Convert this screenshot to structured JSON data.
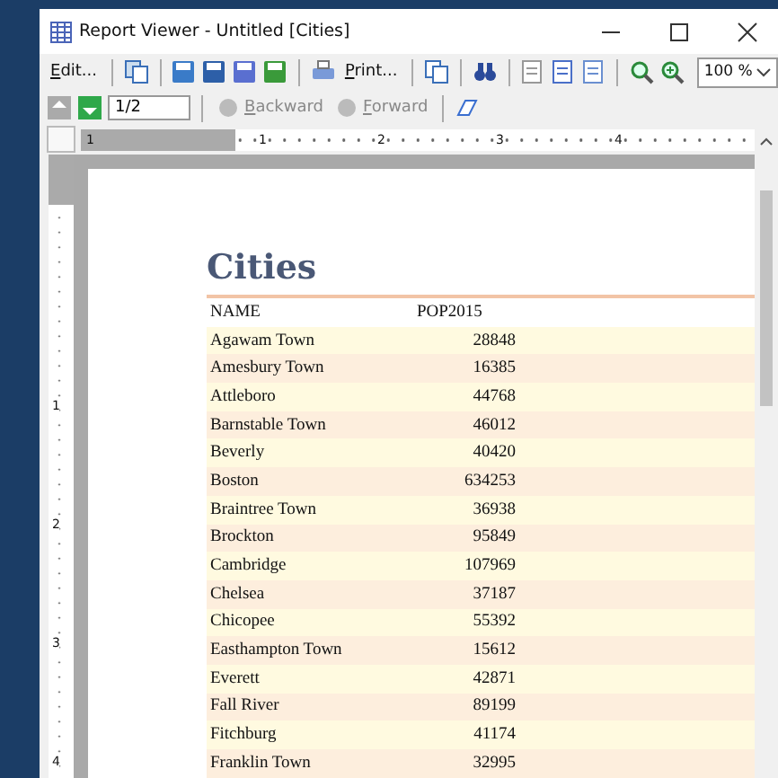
{
  "window": {
    "title": "Report Viewer - Untitled [Cities]"
  },
  "toolbar": {
    "edit": "Edit...",
    "print": "Print...",
    "zoom": "100 %"
  },
  "navigation": {
    "page": "1/2",
    "backward": {
      "label": "Backward",
      "disabled": true
    },
    "forward": {
      "label": "Forward",
      "disabled": true
    }
  },
  "ruler": {
    "horizontal": [
      "1",
      "1",
      "2",
      "3",
      "4"
    ],
    "vertical": [
      "1",
      "2",
      "3",
      "4"
    ]
  },
  "report": {
    "title": "Cities",
    "columns": [
      "NAME",
      "POP2015"
    ],
    "rows": [
      [
        "Agawam Town",
        "28848"
      ],
      [
        "Amesbury Town",
        "16385"
      ],
      [
        "Attleboro",
        "44768"
      ],
      [
        "Barnstable Town",
        "46012"
      ],
      [
        "Beverly",
        "40420"
      ],
      [
        "Boston",
        "634253"
      ],
      [
        "Braintree Town",
        "36938"
      ],
      [
        "Brockton",
        "95849"
      ],
      [
        "Cambridge",
        "107969"
      ],
      [
        "Chelsea",
        "37187"
      ],
      [
        "Chicopee",
        "55392"
      ],
      [
        "Easthampton Town",
        "15612"
      ],
      [
        "Everett",
        "42871"
      ],
      [
        "Fall River",
        "89199"
      ],
      [
        "Fitchburg",
        "41174"
      ],
      [
        "Franklin Town",
        "32995"
      ]
    ]
  }
}
